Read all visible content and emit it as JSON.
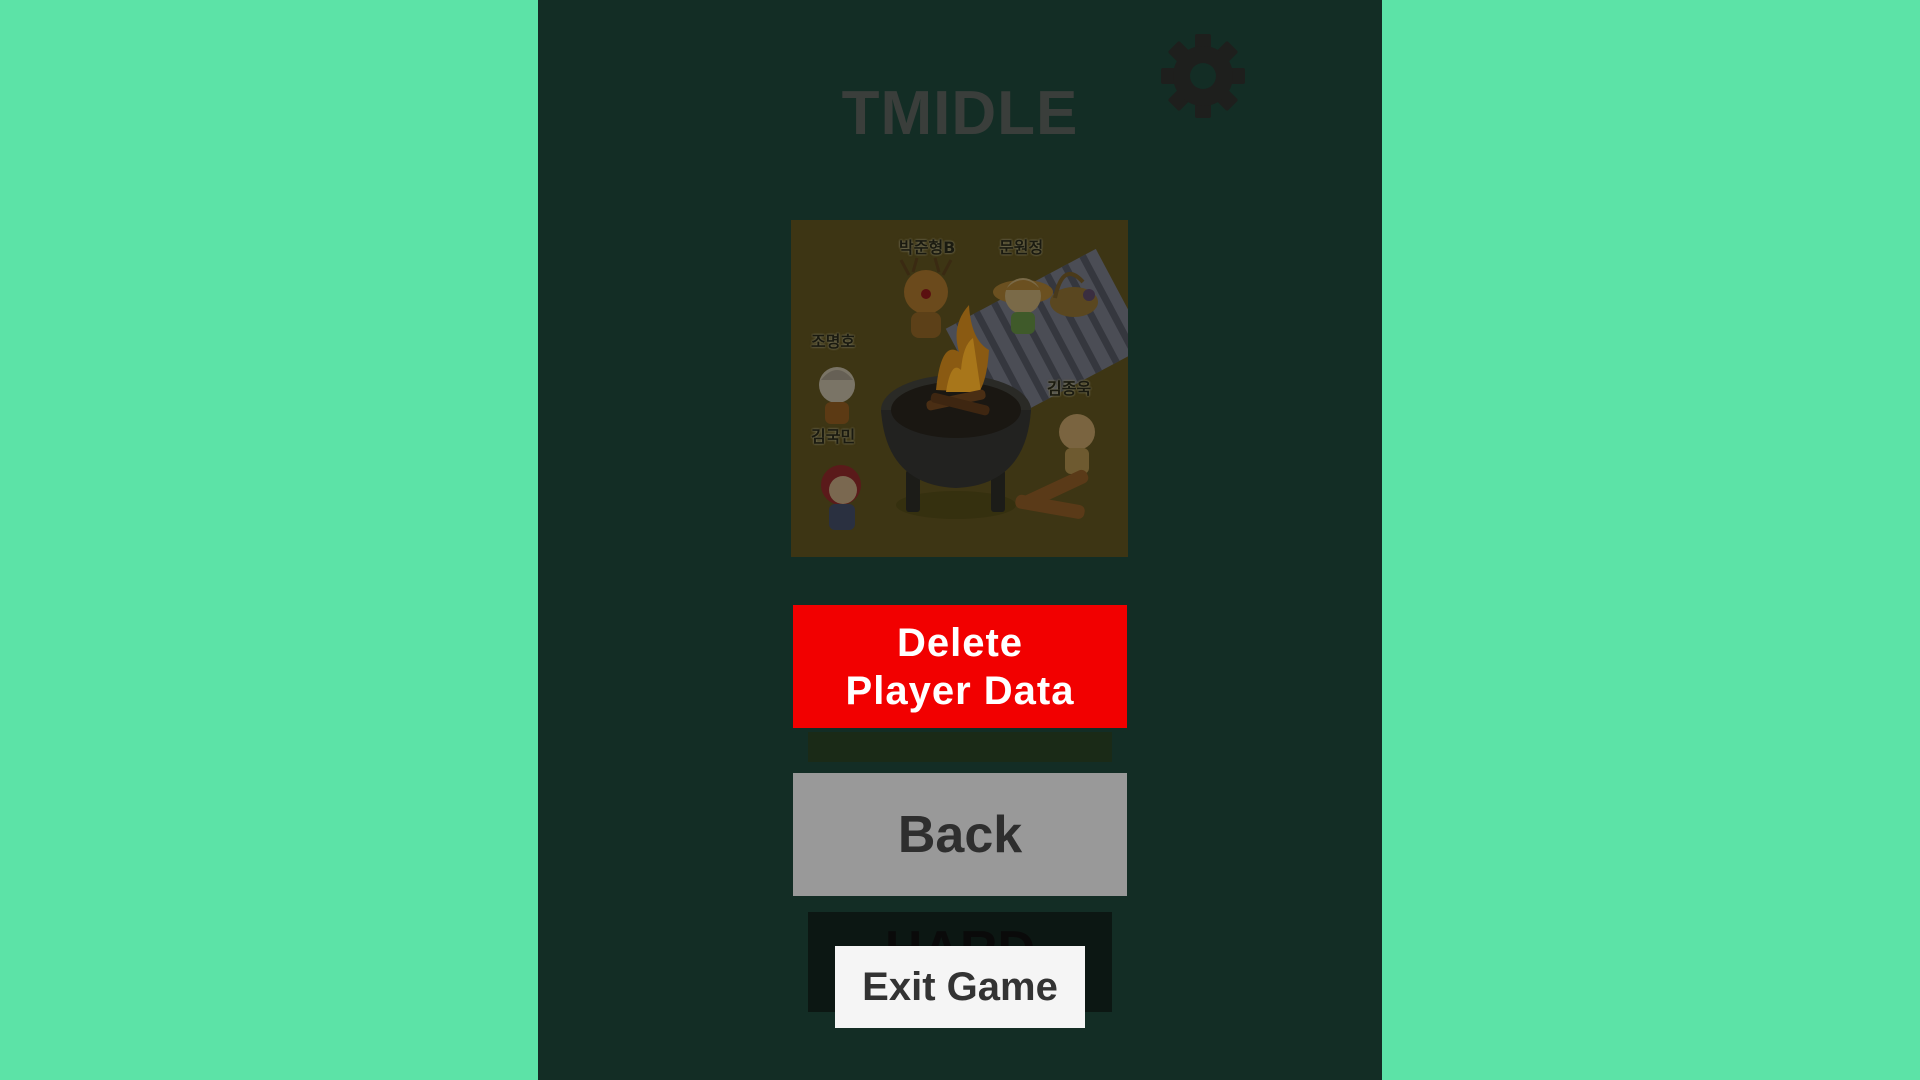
{
  "game": {
    "title": "TMIDLE"
  },
  "settings": {
    "icon": "gear-icon"
  },
  "artwork": {
    "labels": [
      "박준형B",
      "문원정",
      "조명호",
      "김종욱",
      "김국민"
    ]
  },
  "buttons": {
    "delete_line1": "Delete",
    "delete_line2": "Player Data",
    "back": "Back",
    "hard": "HARD",
    "exit": "Exit Game"
  },
  "colors": {
    "page_background": "#5ce3a7",
    "panel_background": "#132d25",
    "delete_button": "#f20000",
    "back_button": "#999999",
    "exit_button": "#f5f5f5"
  }
}
